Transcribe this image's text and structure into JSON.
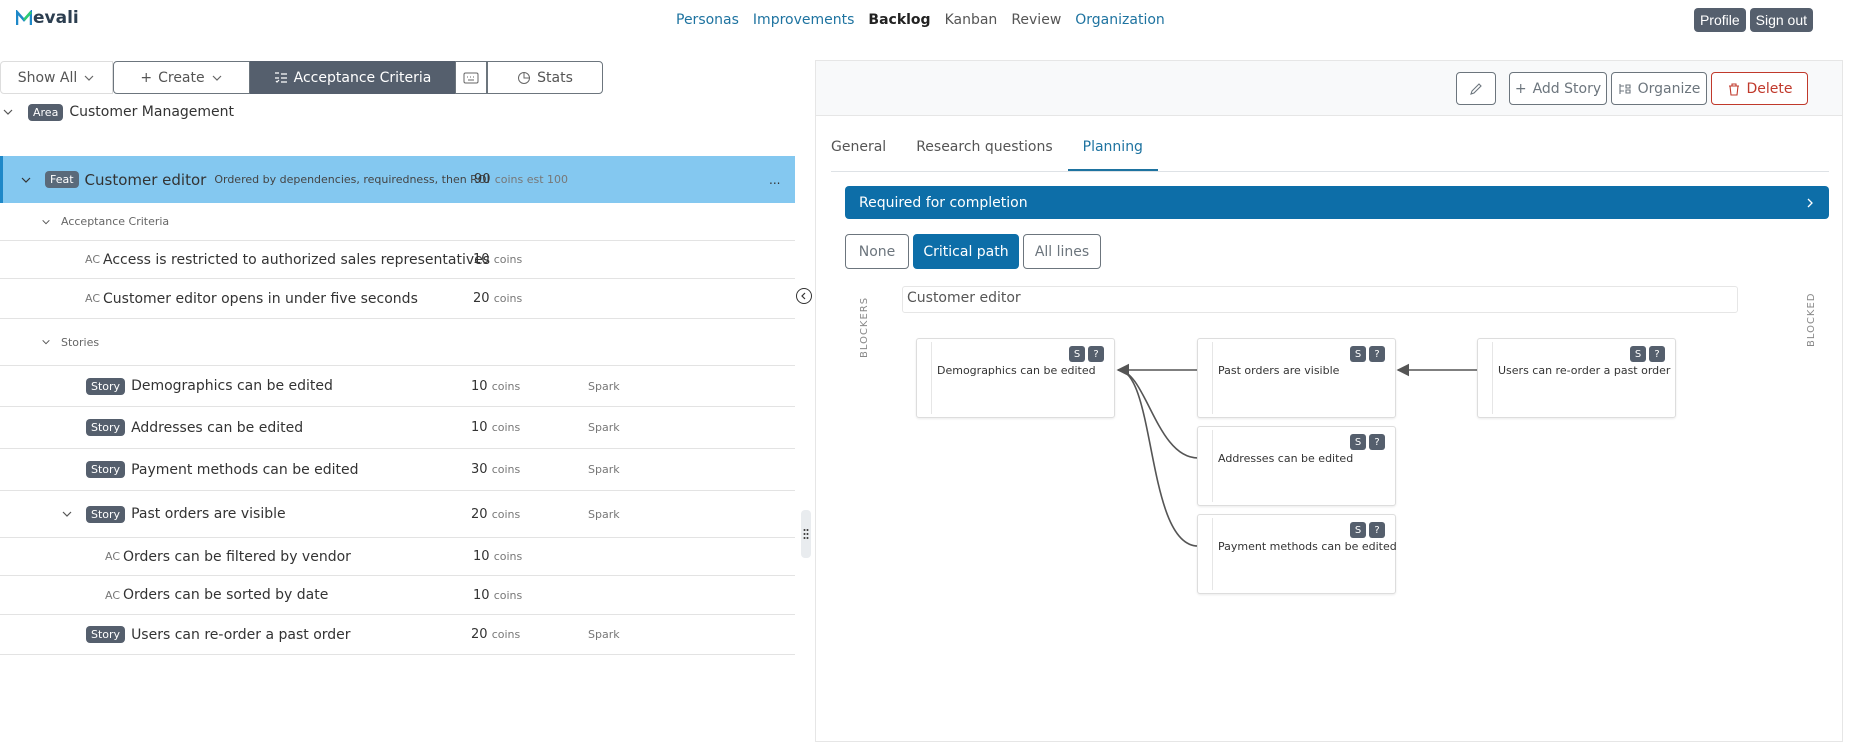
{
  "brand": {
    "name": "evali",
    "letter": "M"
  },
  "nav": {
    "personas": "Personas",
    "improvements": "Improvements",
    "backlog": "Backlog",
    "kanban": "Kanban",
    "review": "Review",
    "organization": "Organization"
  },
  "user": {
    "profile": "Profile",
    "signout": "Sign out"
  },
  "toolbar": {
    "show_all": "Show All",
    "create": "Create",
    "acceptance": "Acceptance Criteria",
    "stats": "Stats"
  },
  "tree": {
    "area": {
      "badge": "Area",
      "title": "Customer Management"
    },
    "feat": {
      "badge": "Feat",
      "title": "Customer editor",
      "note": "Ordered by dependencies, requiredness, then ROI",
      "coins": "90",
      "unit": "coins est 100",
      "menu": "..."
    },
    "ac_section": "Acceptance Criteria",
    "acs": [
      {
        "prefix": "AC",
        "title": "Access is restricted to authorized sales representatives",
        "coins": "10",
        "unit": "coins"
      },
      {
        "prefix": "AC",
        "title": "Customer editor opens in under five seconds",
        "coins": "20",
        "unit": "coins"
      }
    ],
    "stories_section": "Stories",
    "stories": [
      {
        "badge": "Story",
        "title": "Demographics can be edited",
        "coins": "10",
        "unit": "coins",
        "tag": "Spark"
      },
      {
        "badge": "Story",
        "title": "Addresses can be edited",
        "coins": "10",
        "unit": "coins",
        "tag": "Spark"
      },
      {
        "badge": "Story",
        "title": "Payment methods can be edited",
        "coins": "30",
        "unit": "coins",
        "tag": "Spark"
      },
      {
        "badge": "Story",
        "title": "Past orders are visible",
        "coins": "20",
        "unit": "coins",
        "tag": "Spark"
      },
      {
        "badge": "Story",
        "title": "Users can re-order a past order",
        "coins": "20",
        "unit": "coins",
        "tag": "Spark"
      }
    ],
    "sub_acs": [
      {
        "prefix": "AC",
        "title": "Orders can be filtered by vendor",
        "coins": "10",
        "unit": "coins"
      },
      {
        "prefix": "AC",
        "title": "Orders can be sorted by date",
        "coins": "10",
        "unit": "coins"
      }
    ]
  },
  "detail": {
    "add_story": "Add Story",
    "organize": "Organize",
    "delete": "Delete",
    "tabs": {
      "general": "General",
      "research": "Research questions",
      "planning": "Planning"
    },
    "required": "Required for completion",
    "lines": {
      "none": "None",
      "critical": "Critical path",
      "all": "All lines"
    },
    "blockers": "BLOCKERS",
    "blocked": "BLOCKED",
    "graph_title": "Customer editor",
    "node_s": "S",
    "node_q": "?",
    "nodes": {
      "demographics": "Demographics can be edited",
      "past_orders": "Past orders are visible",
      "reorder": "Users can re-order a past order",
      "addresses": "Addresses can be edited",
      "payment": "Payment methods can be edited"
    }
  },
  "colors": {
    "selected_row": "#84c8f0",
    "primary": "#0d6ea8",
    "badge": "#555f6d",
    "danger": "#c0392b"
  }
}
